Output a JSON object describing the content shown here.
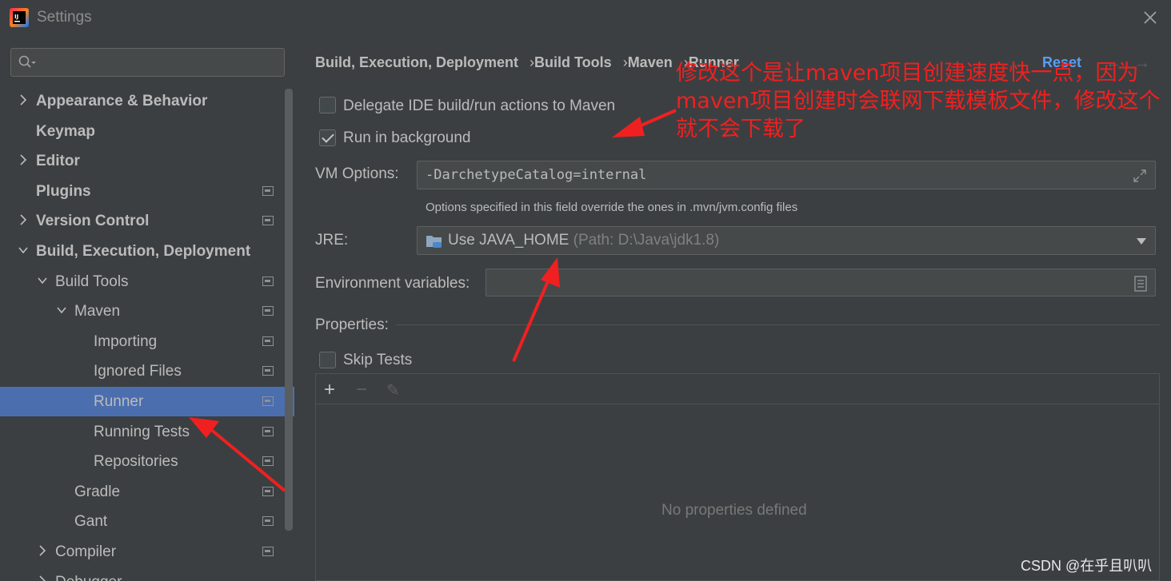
{
  "window": {
    "title": "Settings"
  },
  "sidebar": {
    "search_placeholder": "",
    "items": [
      {
        "label": "Appearance & Behavior",
        "bold": true,
        "indent": 0,
        "chevron": "right",
        "proj": false
      },
      {
        "label": "Keymap",
        "bold": true,
        "indent": 0,
        "chevron": "none",
        "proj": false
      },
      {
        "label": "Editor",
        "bold": true,
        "indent": 0,
        "chevron": "right",
        "proj": false
      },
      {
        "label": "Plugins",
        "bold": true,
        "indent": 0,
        "chevron": "none",
        "proj": true
      },
      {
        "label": "Version Control",
        "bold": true,
        "indent": 0,
        "chevron": "right",
        "proj": true
      },
      {
        "label": "Build, Execution, Deployment",
        "bold": true,
        "indent": 0,
        "chevron": "down",
        "proj": false
      },
      {
        "label": "Build Tools",
        "bold": false,
        "indent": 1,
        "chevron": "down",
        "proj": true
      },
      {
        "label": "Maven",
        "bold": false,
        "indent": 2,
        "chevron": "down",
        "proj": true
      },
      {
        "label": "Importing",
        "bold": false,
        "indent": 3,
        "chevron": "none",
        "proj": true
      },
      {
        "label": "Ignored Files",
        "bold": false,
        "indent": 3,
        "chevron": "none",
        "proj": true
      },
      {
        "label": "Runner",
        "bold": false,
        "indent": 3,
        "chevron": "none",
        "proj": true,
        "selected": true
      },
      {
        "label": "Running Tests",
        "bold": false,
        "indent": 3,
        "chevron": "none",
        "proj": true
      },
      {
        "label": "Repositories",
        "bold": false,
        "indent": 3,
        "chevron": "none",
        "proj": true
      },
      {
        "label": "Gradle",
        "bold": false,
        "indent": 2,
        "chevron": "none",
        "proj": true
      },
      {
        "label": "Gant",
        "bold": false,
        "indent": 2,
        "chevron": "none",
        "proj": true
      },
      {
        "label": "Compiler",
        "bold": false,
        "indent": 1,
        "chevron": "right",
        "proj": true
      },
      {
        "label": "Debugger",
        "bold": false,
        "indent": 1,
        "chevron": "right",
        "proj": false
      }
    ]
  },
  "breadcrumb": {
    "parts": [
      "Build, Execution, Deployment",
      "Build Tools",
      "Maven",
      "Runner"
    ],
    "separator": "›"
  },
  "header": {
    "reset_label": "Reset",
    "back_glyph": "←",
    "forward_glyph": "→"
  },
  "runner": {
    "delegate_label": "Delegate IDE build/run actions to Maven",
    "delegate_checked": false,
    "background_label": "Run in background",
    "background_checked": true,
    "vm_options_label": "VM Options:",
    "vm_options_value": "-DarchetypeCatalog=internal",
    "vm_hint": "Options specified in this field override the ones in .mvn/jvm.config files",
    "jre_label": "JRE:",
    "jre_value": "Use JAVA_HOME",
    "jre_path": "(Path: D:\\Java\\jdk1.8)",
    "env_label": "Environment variables:",
    "env_value": "",
    "properties_label": "Properties:",
    "skip_tests_label": "Skip Tests",
    "skip_tests_checked": false,
    "add_glyph": "+",
    "remove_glyph": "−",
    "edit_glyph": "✎",
    "empty_text": "No properties defined"
  },
  "annotation": {
    "lines": [
      "修改这个是让maven项目创建速度快一点，因为",
      "maven项目创建时会联网下载模板文件，修改这个",
      "就不会下载了"
    ]
  },
  "watermark": "CSDN @在乎且叭叭",
  "colors": {
    "background": "#3c3f41",
    "selection": "#4b6eaf",
    "link": "#589df6",
    "annotation": "#f02020"
  }
}
